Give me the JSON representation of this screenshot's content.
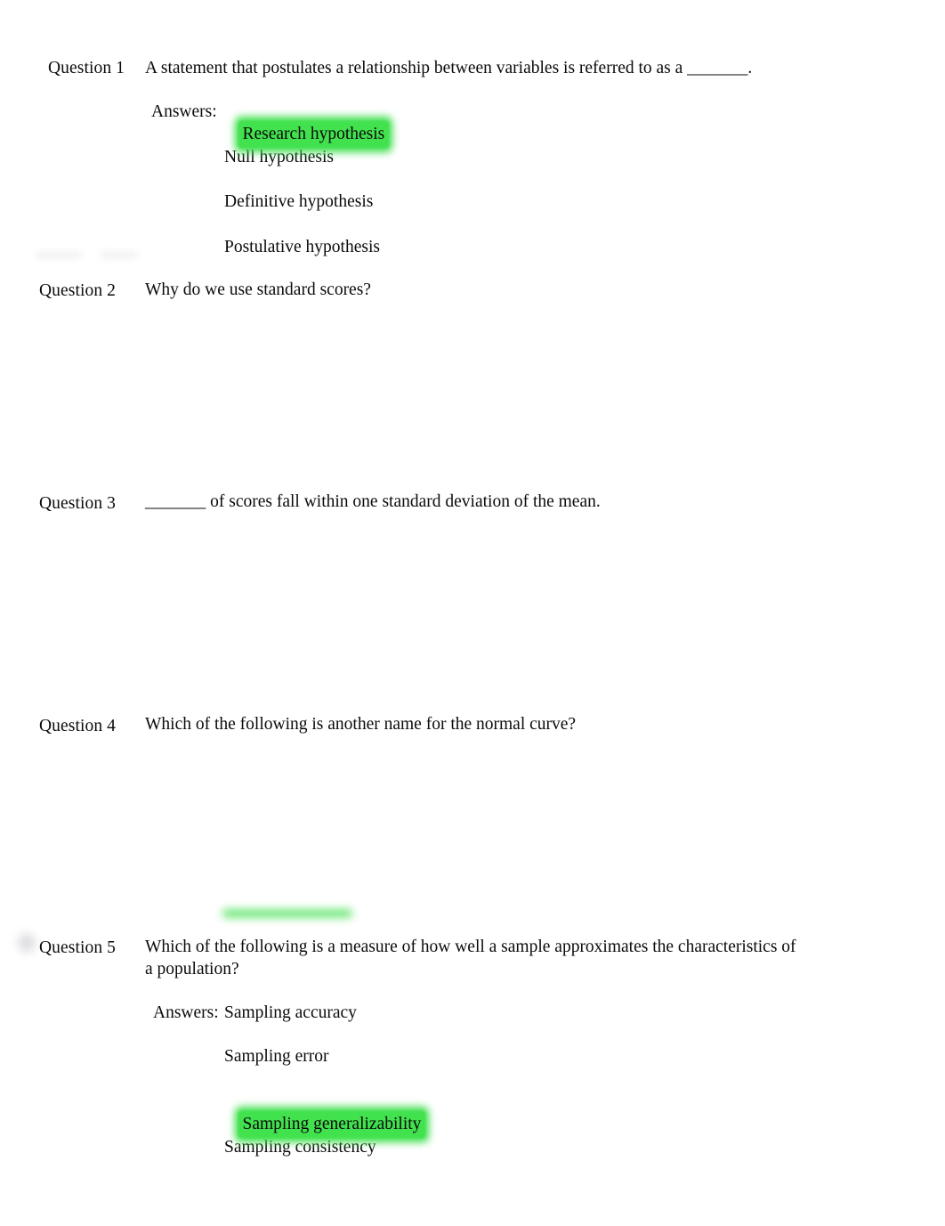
{
  "document": {
    "title": "Quiz Review",
    "highlight_color": "#3fe04d",
    "text_color": "#0b0b0b",
    "background_color": "#ffffff",
    "answers_label": "Answers:"
  },
  "questions": [
    {
      "label": "Question 1",
      "text": "A statement that postulates a relationship between variables is referred to as a _______.",
      "answers_label": "Answers:",
      "options": [
        {
          "text": "Research hypothesis",
          "highlighted": true
        },
        {
          "text": "Null hypothesis",
          "highlighted": false
        },
        {
          "text": "Definitive hypothesis",
          "highlighted": false
        },
        {
          "text": "Postulative hypothesis",
          "highlighted": false
        }
      ]
    },
    {
      "label": "Question 2",
      "text": "Why do we use standard scores?",
      "answers_label": "",
      "options": []
    },
    {
      "label": "Question 3",
      "text": "_______ of scores fall within one standard deviation of the mean.",
      "answers_label": "",
      "options": []
    },
    {
      "label": "Question 4",
      "text": "Which of the following is another name for the normal curve?",
      "answers_label": "",
      "options": []
    },
    {
      "label": "Question 5",
      "text": "Which of the following is a measure of how well a sample approximates the characteristics of a population?",
      "answers_label": "Answers:",
      "options": [
        {
          "text": "Sampling accuracy",
          "highlighted": false
        },
        {
          "text": "Sampling error",
          "highlighted": false
        },
        {
          "text": "Sampling generalizability",
          "highlighted": true
        },
        {
          "text": "Sampling consistency",
          "highlighted": false
        }
      ]
    }
  ]
}
